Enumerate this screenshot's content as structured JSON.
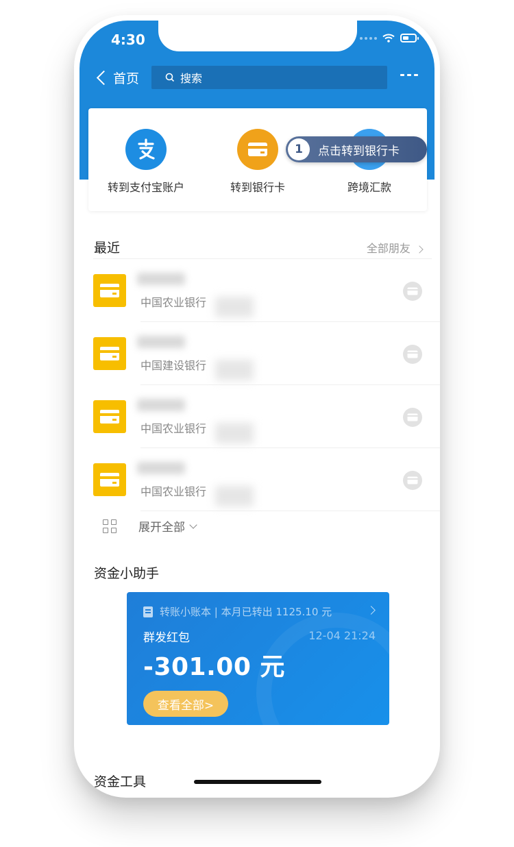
{
  "status_bar": {
    "time": "4:30"
  },
  "nav": {
    "back_label": "首页",
    "search_placeholder": "搜索"
  },
  "quick_actions": [
    {
      "label": "转到支付宝账户",
      "icon": "alipay-icon",
      "color": "#1d8de2"
    },
    {
      "label": "转到银行卡",
      "icon": "bank-card-icon",
      "color": "#f0a21a"
    },
    {
      "label": "跨境汇款",
      "icon": "globe-icon",
      "color": "#3ba0ef"
    }
  ],
  "tooltip": {
    "step": "1",
    "text": "点击转到银行卡"
  },
  "recent": {
    "title": "最近",
    "all_friends": "全部朋友",
    "contacts": [
      {
        "bank": "中国农业银行"
      },
      {
        "bank": "中国建设银行"
      },
      {
        "bank": "中国农业银行"
      },
      {
        "bank": "中国农业银行"
      }
    ],
    "expand_label": "展开全部"
  },
  "assistant": {
    "title": "资金小助手",
    "card_header": "转账小账本 | 本月已转出 1125.10 元",
    "transaction_type": "群发红包",
    "transaction_time": "12-04 21:24",
    "amount": "-301.00 元",
    "view_all": "查看全部>"
  },
  "tools": {
    "title": "资金工具"
  },
  "colors": {
    "primary_blue": "#1c88da",
    "bank_yellow": "#f7be00",
    "button_gold": "#f4c35b"
  }
}
